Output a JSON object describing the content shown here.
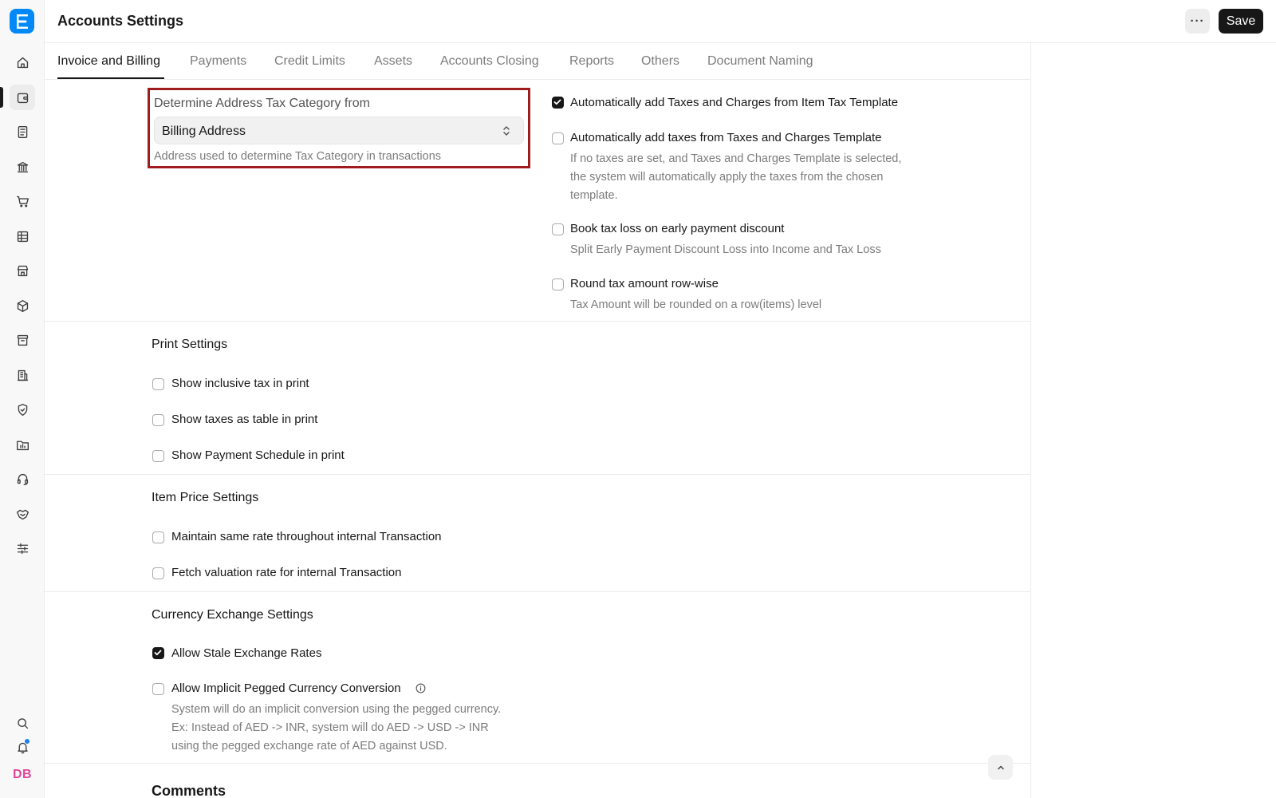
{
  "header": {
    "title": "Accounts Settings",
    "more_label": "···",
    "save_label": "Save"
  },
  "sidebar": {
    "logo_letter": "E",
    "items": [
      {
        "icon": "home-icon"
      },
      {
        "icon": "wallet-icon",
        "active": true
      },
      {
        "icon": "document-icon"
      },
      {
        "icon": "bank-icon"
      },
      {
        "icon": "cart-icon"
      },
      {
        "icon": "table-icon"
      },
      {
        "icon": "store-icon"
      },
      {
        "icon": "box-icon"
      },
      {
        "icon": "archive-icon"
      },
      {
        "icon": "building-icon"
      },
      {
        "icon": "shield-icon"
      },
      {
        "icon": "folder-chart-icon"
      },
      {
        "icon": "headset-icon"
      },
      {
        "icon": "handshake-icon"
      },
      {
        "icon": "sliders-icon"
      }
    ],
    "bottom": [
      {
        "icon": "search-icon"
      },
      {
        "icon": "bell-icon"
      }
    ],
    "avatar_initials": "DB"
  },
  "tabs": [
    {
      "label": "Invoice and Billing",
      "active": true
    },
    {
      "label": "Payments"
    },
    {
      "label": "Credit Limits"
    },
    {
      "label": "Assets"
    },
    {
      "label": "Accounts Closing"
    },
    {
      "label": "Reports"
    },
    {
      "label": "Others"
    },
    {
      "label": "Document Naming"
    }
  ],
  "tax_category": {
    "label": "Determine Address Tax Category from",
    "value": "Billing Address",
    "help": "Address used to determine Tax Category in transactions"
  },
  "right_options": [
    {
      "label": "Automatically add Taxes and Charges from Item Tax Template",
      "checked": true,
      "desc": ""
    },
    {
      "label": "Automatically add taxes from Taxes and Charges Template",
      "checked": false,
      "desc": [
        "If no taxes are set, and Taxes and Charges Template is selected,",
        "the system will automatically apply the taxes from the chosen",
        "template."
      ]
    },
    {
      "label": "Book tax loss on early payment discount",
      "checked": false,
      "desc": [
        "Split Early Payment Discount Loss into Income and Tax Loss"
      ]
    },
    {
      "label": "Round tax amount row-wise",
      "checked": false,
      "desc": [
        "Tax Amount will be rounded on a row(items) level"
      ]
    }
  ],
  "print_settings": {
    "title": "Print Settings",
    "options": [
      {
        "label": "Show inclusive tax in print",
        "checked": false
      },
      {
        "label": "Show taxes as table in print",
        "checked": false
      },
      {
        "label": "Show Payment Schedule in print",
        "checked": false
      }
    ]
  },
  "item_price_settings": {
    "title": "Item Price Settings",
    "options": [
      {
        "label": "Maintain same rate throughout internal Transaction",
        "checked": false
      },
      {
        "label": "Fetch valuation rate for internal Transaction",
        "checked": false
      }
    ]
  },
  "currency_exchange_settings": {
    "title": "Currency Exchange Settings",
    "options": [
      {
        "label": "Allow Stale Exchange Rates",
        "checked": true
      },
      {
        "label": "Allow Implicit Pegged Currency Conversion",
        "checked": false,
        "desc": [
          "System will do an implicit conversion using the pegged currency.",
          "Ex: Instead of AED -> INR, system will do AED -> USD -> INR",
          "using the pegged exchange rate of AED against USD."
        ]
      }
    ]
  },
  "comments": {
    "title": "Comments"
  },
  "colors": {
    "brand": "#0289f7",
    "highlight_border": "#a01c1c",
    "primary_button": "#171717",
    "avatar_text": "#e0469b"
  }
}
